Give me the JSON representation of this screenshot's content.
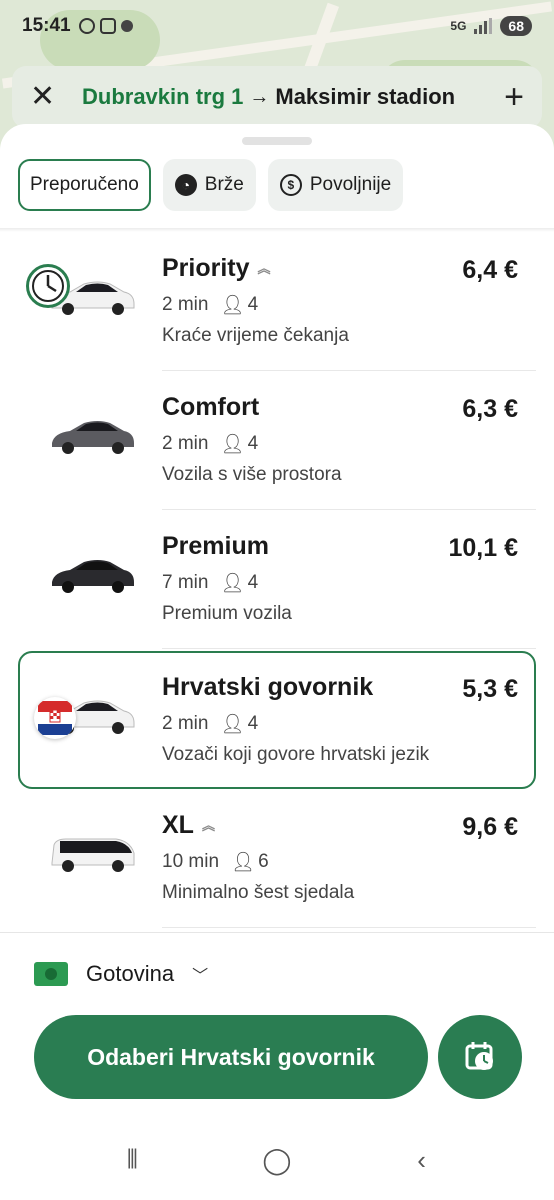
{
  "status_bar": {
    "time": "15:41",
    "network": "5G",
    "battery": "68"
  },
  "route": {
    "from": "Dubravkin trg 1",
    "to": "Maksimir stadion"
  },
  "filters": [
    {
      "label": "Preporučeno",
      "active": true
    },
    {
      "label": "Brže",
      "icon": "clock-icon"
    },
    {
      "label": "Povoljnije",
      "icon": "dollar-icon"
    }
  ],
  "options": [
    {
      "name": "Priority",
      "eta": "2 min",
      "seats": "4",
      "description": "Kraće vrijeme čekanja",
      "price": "6,4 €",
      "badge": "clock-icon",
      "car_color": "#1c1c22",
      "boost": true
    },
    {
      "name": "Comfort",
      "eta": "2 min",
      "seats": "4",
      "description": "Vozila s više prostora",
      "price": "6,3 €",
      "car_color": "#5b5b60"
    },
    {
      "name": "Premium",
      "eta": "7 min",
      "seats": "4",
      "description": "Premium vozila",
      "price": "10,1 €",
      "car_color": "#222226"
    },
    {
      "name": "Hrvatski govornik",
      "eta": "2 min",
      "seats": "4",
      "description": "Vozači koji govore hrvatski jezik",
      "price": "5,3 €",
      "badge": "croatia-flag-icon",
      "car_color": "#1c1c22",
      "selected": true
    },
    {
      "name": "XL",
      "eta": "10 min",
      "seats": "6",
      "description": "Minimalno šest sjedala",
      "price": "9,6 €",
      "car_color": "#222",
      "boost": true
    }
  ],
  "payment": {
    "method": "Gotovina"
  },
  "cta": {
    "label": "Odaberi Hrvatski govornik"
  },
  "colors": {
    "brand_green": "#2a7d52",
    "route_from": "#1b7a3f"
  }
}
